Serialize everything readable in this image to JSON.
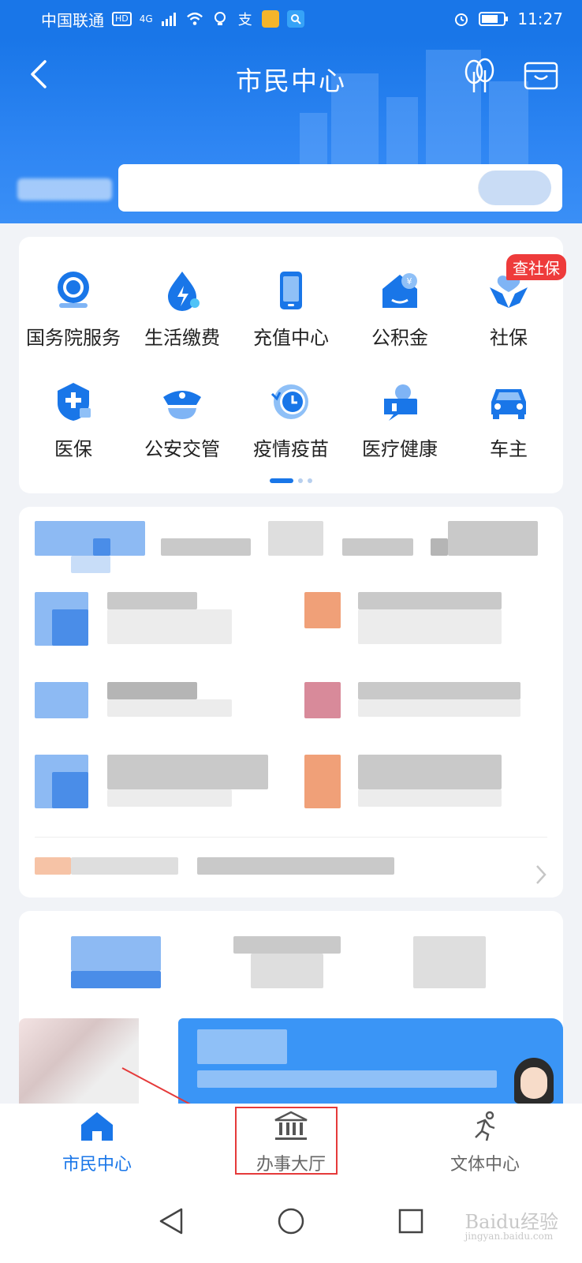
{
  "status_bar": {
    "carrier": "中国联通",
    "hd": "HD",
    "network": "4G",
    "time": "11:27",
    "icons": [
      "signal-icon",
      "wifi-icon",
      "bulb-icon",
      "alipay-icon",
      "app-icon",
      "search-app-icon",
      "alarm-icon",
      "battery-icon"
    ]
  },
  "header": {
    "title": "市民中心",
    "icons": [
      "back-icon",
      "tree-icon",
      "wallet-icon"
    ],
    "search_placeholder": ""
  },
  "services": {
    "items": [
      {
        "label": "国务院服务",
        "icon": "state-council-icon"
      },
      {
        "label": "生活缴费",
        "icon": "utility-payment-icon"
      },
      {
        "label": "充值中心",
        "icon": "recharge-icon"
      },
      {
        "label": "公积金",
        "icon": "housing-fund-icon"
      },
      {
        "label": "社保",
        "icon": "social-security-icon",
        "badge": "查社保"
      },
      {
        "label": "医保",
        "icon": "medical-insurance-icon"
      },
      {
        "label": "公安交管",
        "icon": "police-traffic-icon"
      },
      {
        "label": "疫情疫苗",
        "icon": "vaccine-icon"
      },
      {
        "label": "医疗健康",
        "icon": "healthcare-icon"
      },
      {
        "label": "车主",
        "icon": "car-owner-icon"
      }
    ],
    "page_indicator": {
      "pages": 3,
      "active": 1
    }
  },
  "bottom_nav": {
    "items": [
      {
        "label": "市民中心",
        "icon": "home-icon",
        "active": true
      },
      {
        "label": "办事大厅",
        "icon": "government-hall-icon",
        "active": false
      },
      {
        "label": "文体中心",
        "icon": "running-icon",
        "active": false
      }
    ]
  },
  "watermark": {
    "brand": "Baidu经验",
    "url": "jingyan.baidu.com"
  },
  "colors": {
    "brand": "#1976e8",
    "badge": "#ee3b3b",
    "highlight": "#e53a3a"
  }
}
